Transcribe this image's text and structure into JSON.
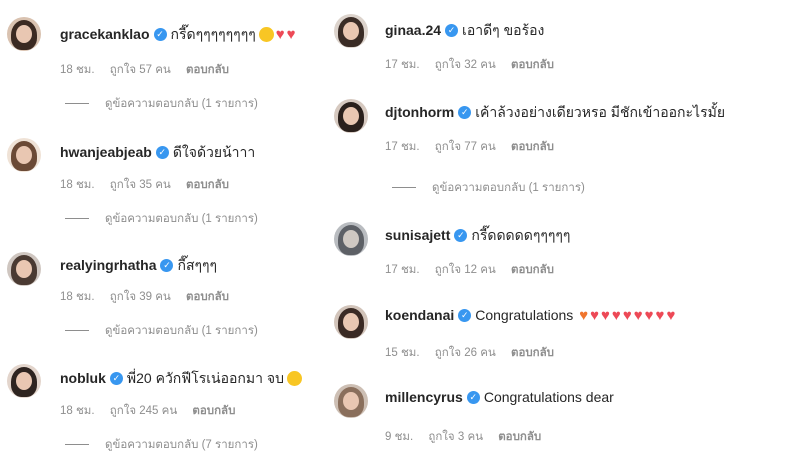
{
  "colors": {
    "verified": "#3897f0",
    "meta_text": "#8e8e8e",
    "text": "#262626",
    "heart": "#ed4956"
  },
  "left_comments": [
    {
      "username": "gracekanklao",
      "text": "กรี๊ดๆๆๆๆๆๆๆๆ",
      "emoji": [
        "heart-eyes-face-icon",
        "red-heart-icon",
        "red-heart-icon"
      ],
      "time": "18 ชม.",
      "likes": "ถูกใจ 57 คน",
      "reply": "ตอบกลับ",
      "view_replies": "ดูข้อความตอบกลับ (1 รายการ)"
    },
    {
      "username": "hwanjeabjeab",
      "text": "ดีใจด้วยน้าาา",
      "emoji": [],
      "time": "18 ชม.",
      "likes": "ถูกใจ 35 คน",
      "reply": "ตอบกลับ",
      "view_replies": "ดูข้อความตอบกลับ (1 รายการ)"
    },
    {
      "username": "realyingrhatha",
      "text": "กี๊สๆๆๆ",
      "emoji": [],
      "time": "18 ชม.",
      "likes": "ถูกใจ 39 คน",
      "reply": "ตอบกลับ",
      "view_replies": "ดูข้อความตอบกลับ (1 รายการ)"
    },
    {
      "username": "nobluk",
      "text": "พี่20 ควักฟีโรเน่ออกมา จบ",
      "emoji": [
        "laughing-face-icon"
      ],
      "time": "18 ชม.",
      "likes": "ถูกใจ 245 คน",
      "reply": "ตอบกลับ",
      "view_replies": "ดูข้อความตอบกลับ (7 รายการ)"
    }
  ],
  "right_comments": [
    {
      "username": "ginaa.24",
      "text": "เอาดีๆ ขอร้อง",
      "time": "17 ชม.",
      "likes": "ถูกใจ 32 คน",
      "reply": "ตอบกลับ",
      "view_replies": ""
    },
    {
      "username": "djtonhorm",
      "text": "เค้าล้วงอย่างเดียวหรอ มีชักเข้าออกะไรมั้ย",
      "time": "17 ชม.",
      "likes": "ถูกใจ 77 คน",
      "reply": "ตอบกลับ",
      "view_replies": "ดูข้อความตอบกลับ (1 รายการ)"
    },
    {
      "username": "sunisajett",
      "text": "กรี๊ดดดดดๆๆๆๆๆ",
      "time": "17 ชม.",
      "likes": "ถูกใจ 12 คน",
      "reply": "ตอบกลับ",
      "view_replies": ""
    },
    {
      "username": "koendanai",
      "text": "Congratulations",
      "time": "15 ชม.",
      "likes": "ถูกใจ 26 คน",
      "reply": "ตอบกลับ",
      "view_replies": ""
    },
    {
      "username": "millencyrus",
      "text": "Congratulations dear",
      "time": "9 ชม.",
      "likes": "ถูกใจ 3 คน",
      "reply": "ตอบกลับ",
      "view_replies": ""
    }
  ]
}
